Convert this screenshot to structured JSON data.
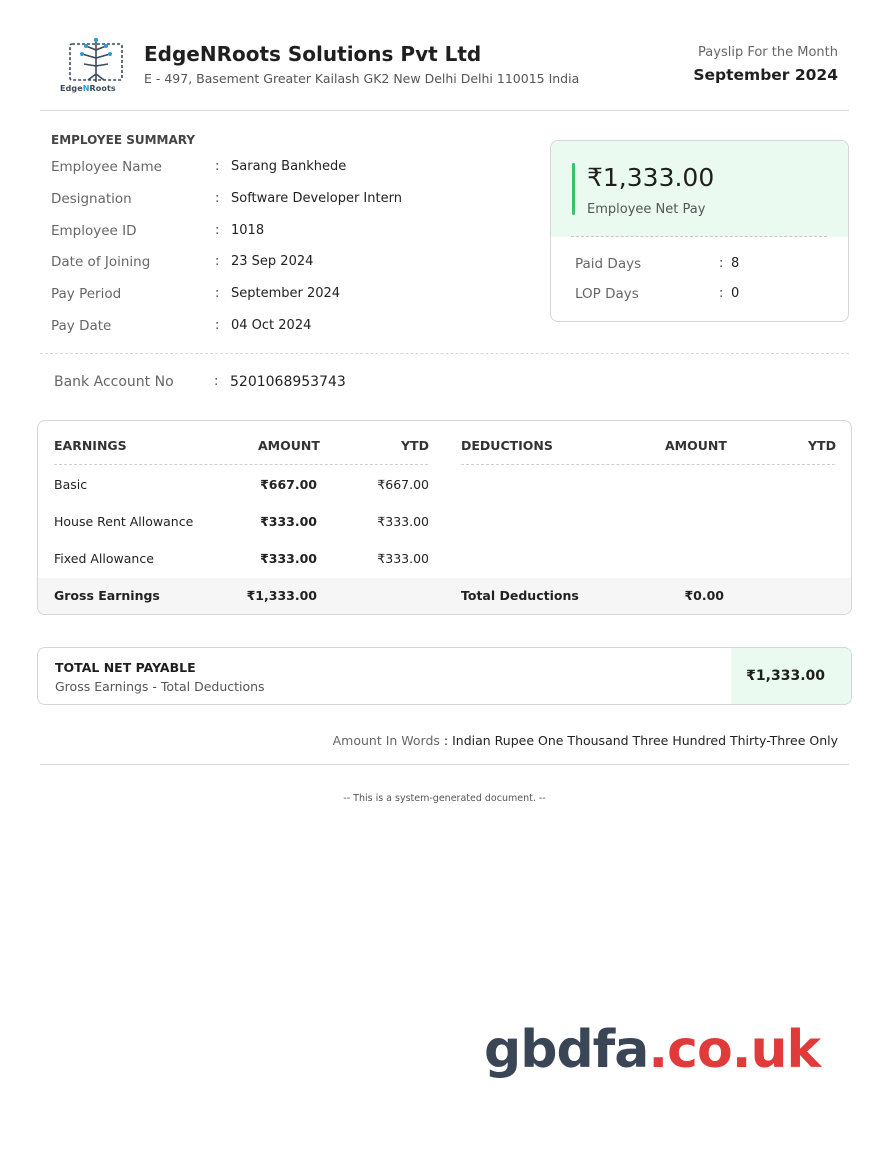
{
  "company": {
    "logo_text_a": "Edge",
    "logo_text_b": "N",
    "logo_text_c": "Roots",
    "name": "EdgeNRoots Solutions Pvt Ltd",
    "address": "E - 497, Basement Greater Kailash GK2 New Delhi Delhi 110015 India"
  },
  "payslip": {
    "month_label": "Payslip For the Month",
    "month_value": "September 2024"
  },
  "summary": {
    "title": "EMPLOYEE SUMMARY",
    "colon": ":",
    "rows": [
      {
        "label": "Employee Name",
        "value": "Sarang Bankhede"
      },
      {
        "label": "Designation",
        "value": "Software Developer Intern"
      },
      {
        "label": "Employee ID",
        "value": "1018"
      },
      {
        "label": "Date of Joining",
        "value": "23 Sep 2024"
      },
      {
        "label": "Pay Period",
        "value": "September 2024"
      },
      {
        "label": "Pay Date",
        "value": "04 Oct 2024"
      }
    ]
  },
  "net_pay_card": {
    "amount": "₹1,333.00",
    "label": "Employee Net Pay",
    "paid_days_label": "Paid Days",
    "paid_days_value": "8",
    "lop_days_label": "LOP Days",
    "lop_days_value": "0"
  },
  "bank": {
    "label": "Bank Account No",
    "value": "5201068953743"
  },
  "earnings_table": {
    "headers": {
      "earnings": "EARNINGS",
      "amount": "AMOUNT",
      "ytd": "YTD",
      "deductions": "DEDUCTIONS",
      "ded_amount": "AMOUNT",
      "ded_ytd": "YTD"
    },
    "rows": [
      {
        "name": "Basic",
        "amount": "₹667.00",
        "ytd": "₹667.00"
      },
      {
        "name": "House Rent Allowance",
        "amount": "₹333.00",
        "ytd": "₹333.00"
      },
      {
        "name": "Fixed Allowance",
        "amount": "₹333.00",
        "ytd": "₹333.00"
      }
    ],
    "gross_label": "Gross Earnings",
    "gross_amount": "₹1,333.00",
    "total_deductions_label": "Total Deductions",
    "total_deductions_amount": "₹0.00"
  },
  "total_net": {
    "title": "TOTAL NET PAYABLE",
    "subtitle": "Gross Earnings - Total Deductions",
    "amount": "₹1,333.00"
  },
  "amount_words": {
    "label": "Amount In Words",
    "value": " : Indian Rupee One Thousand Three Hundred Thirty-Three Only"
  },
  "footer": {
    "note": "-- This is a system-generated document. --"
  },
  "watermark": {
    "main": "gbdfa",
    "accent": ".co.uk"
  },
  "colors": {
    "accent_green": "#3dbf6a",
    "green_bg": "#eafaf0",
    "watermark_dark": "#3a4656",
    "watermark_red": "#e03a3a"
  }
}
